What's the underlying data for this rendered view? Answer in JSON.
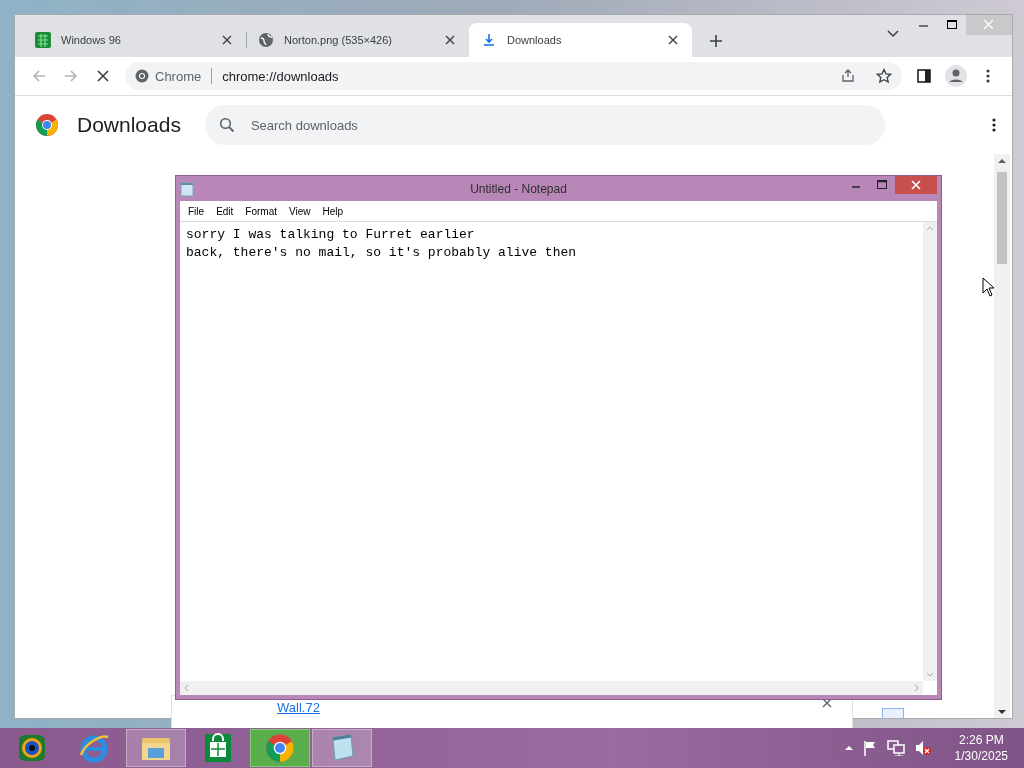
{
  "browser": {
    "tabs": [
      {
        "title": "Windows 96",
        "selected": false
      },
      {
        "title": "Norton.png (535×426)",
        "selected": false
      },
      {
        "title": "Downloads",
        "selected": true
      }
    ],
    "omnibox": {
      "site_label": "Chrome",
      "url": "chrome://downloads"
    },
    "loading": true,
    "page": {
      "title": "Downloads",
      "search": {
        "placeholder": "Search downloads"
      },
      "downloads": [
        {
          "file_name": "Wall.72"
        }
      ]
    }
  },
  "notepad": {
    "title": "Untitled - Notepad",
    "menu": [
      "File",
      "Edit",
      "Format",
      "View",
      "Help"
    ],
    "text": "sorry I was talking to Furret earlier\nback, there's no mail, so it's probably alive then"
  },
  "taskbar": {
    "apps": [
      {
        "kind": "media",
        "running": false
      },
      {
        "kind": "ie",
        "running": false
      },
      {
        "kind": "explorer",
        "running": true
      },
      {
        "kind": "store",
        "running": false
      },
      {
        "kind": "chrome",
        "running": true
      },
      {
        "kind": "notepad",
        "running": true
      }
    ],
    "time": "2:26 PM",
    "date": "1/30/2025"
  }
}
